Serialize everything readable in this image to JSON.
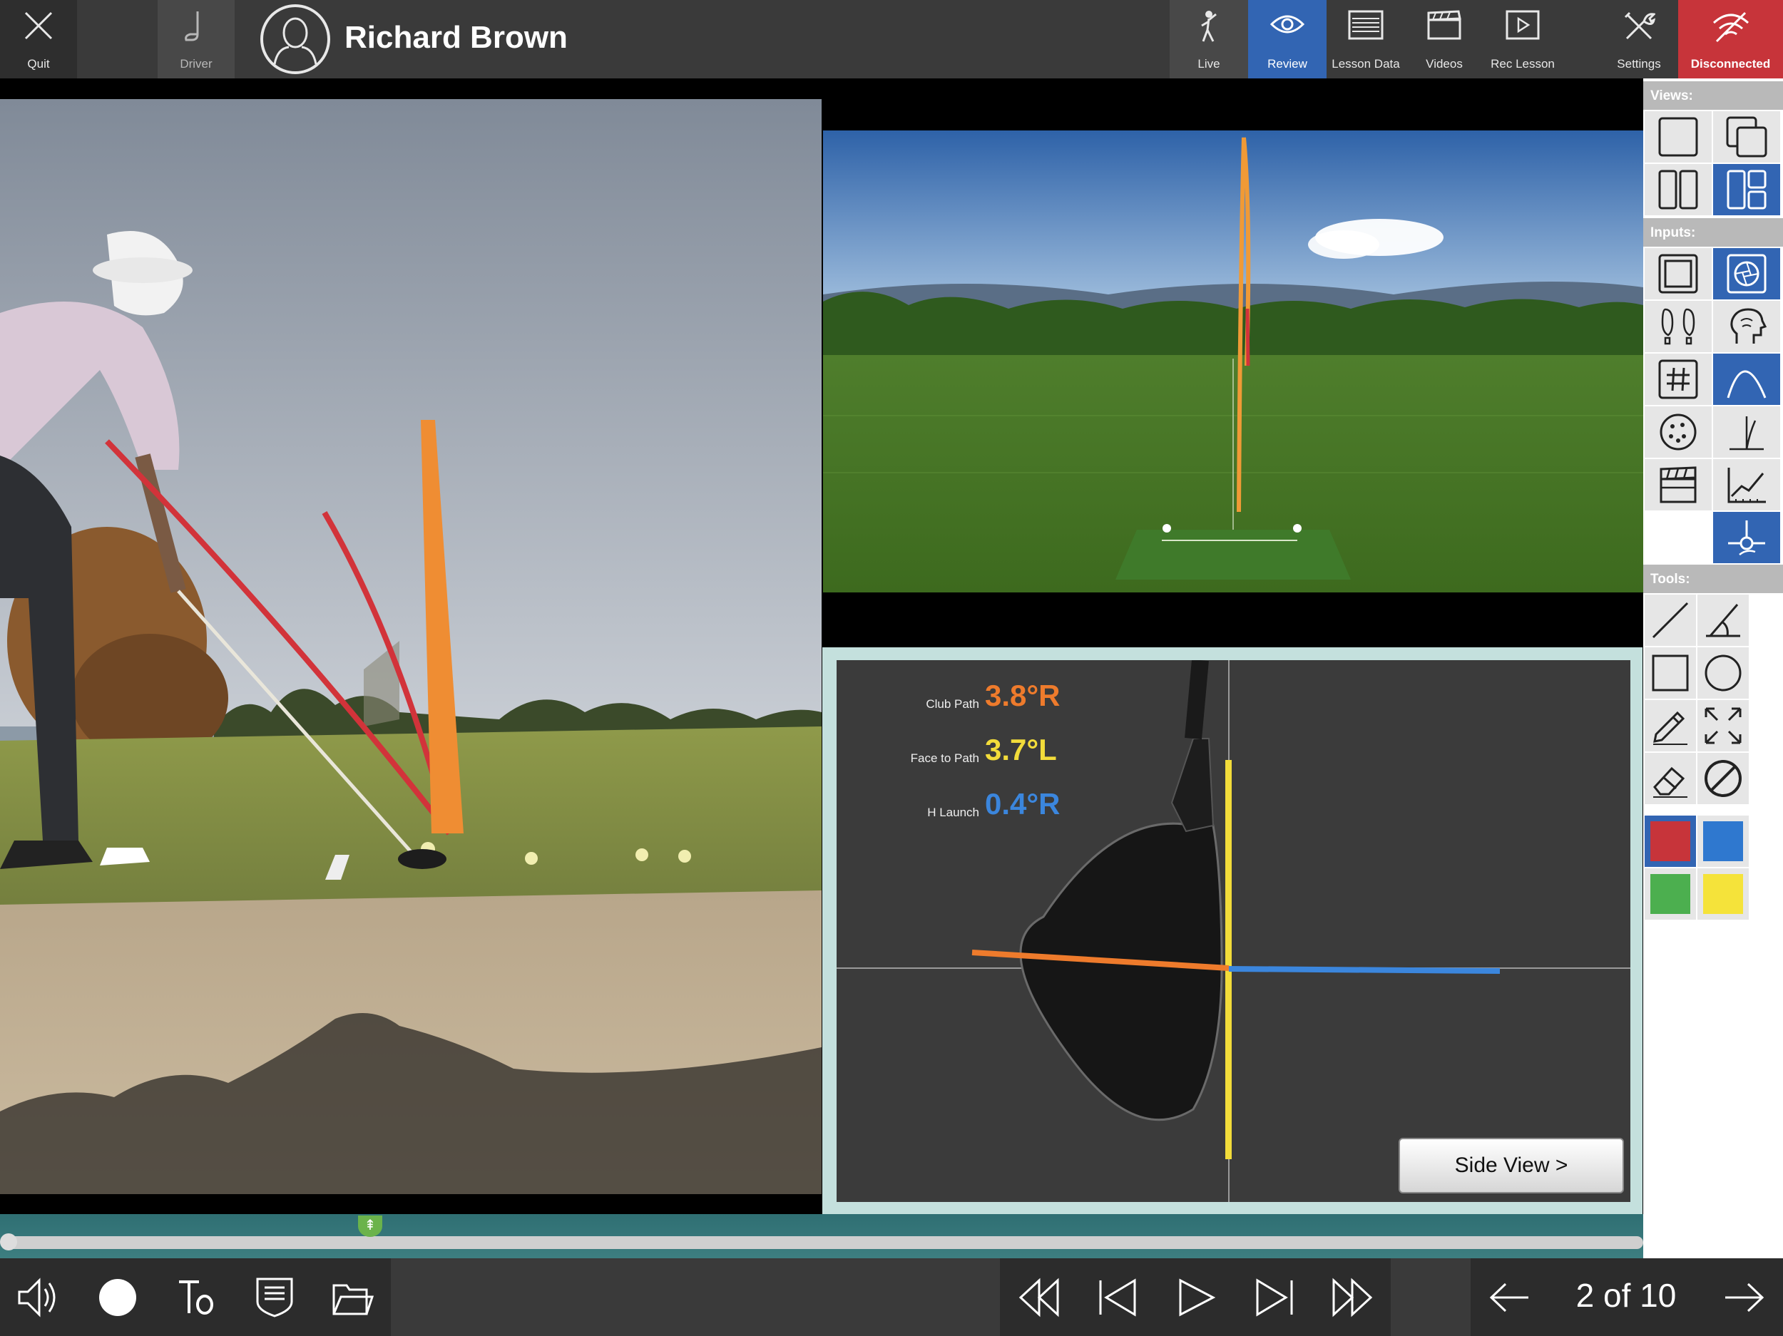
{
  "topbar": {
    "quit_label": "Quit",
    "club_label": "Driver",
    "player_name": "Richard Brown",
    "tabs": [
      {
        "label": "Live"
      },
      {
        "label": "Review"
      },
      {
        "label": "Lesson Data"
      },
      {
        "label": "Videos"
      },
      {
        "label": "Rec Lesson"
      }
    ],
    "settings_label": "Settings",
    "connection_label": "Disconnected"
  },
  "metrics": {
    "club_path": {
      "label": "Club Path",
      "value": "3.8°R",
      "color": "#ee7b2c"
    },
    "face_to_path": {
      "label": "Face to Path",
      "value": "3.7°L",
      "color": "#f2dc3a"
    },
    "h_launch": {
      "label": "H Launch",
      "value": "0.4°R",
      "color": "#3b86dd"
    }
  },
  "side_view_label": "Side View >",
  "sidebar": {
    "views_header": "Views:",
    "inputs_header": "Inputs:",
    "tools_header": "Tools:",
    "colors": [
      "#c7343a",
      "#2f78cf",
      "#4caf4f",
      "#f5e33a"
    ]
  },
  "playback": {
    "page_indicator": "2 of 10",
    "progress": 0.0
  },
  "theme": {
    "accent": "#3265b3",
    "alert": "#c7343a"
  }
}
